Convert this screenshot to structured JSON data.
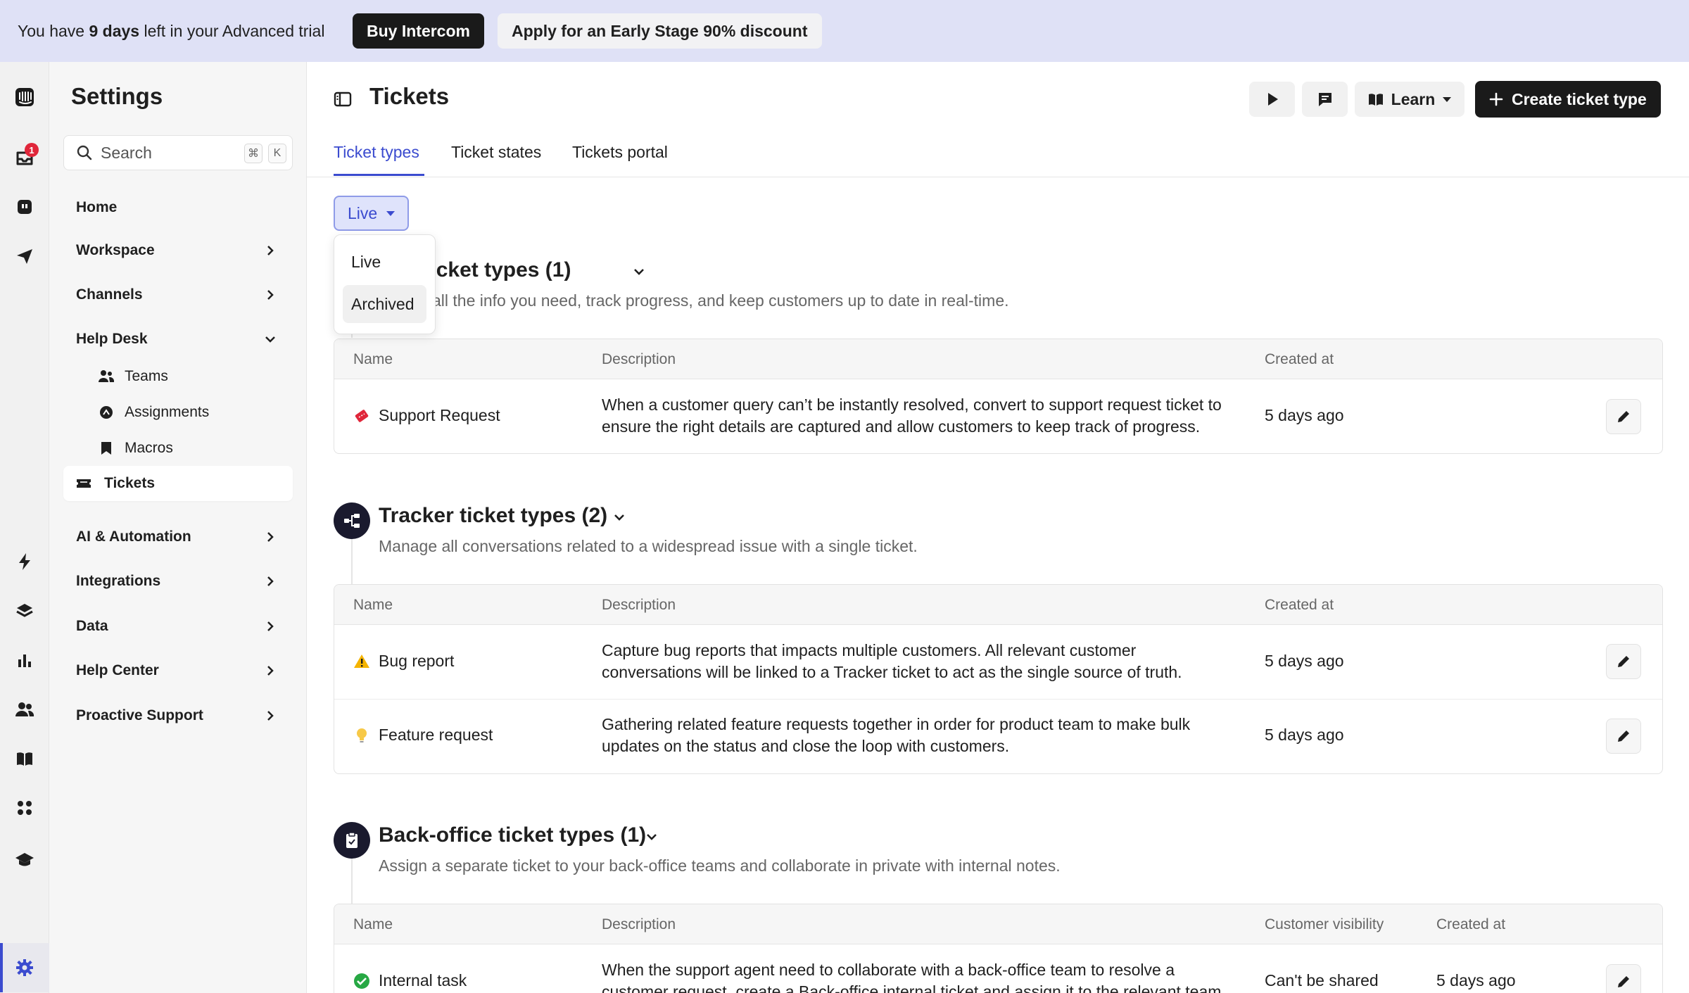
{
  "banner": {
    "prefix": "You have ",
    "days": "9 days",
    "suffix": " left in your Advanced trial",
    "buy_label": "Buy Intercom",
    "discount_label": "Apply for an Early Stage 90% discount"
  },
  "rail": {
    "inbox_badge": "1",
    "icons": [
      "intercom-logo-icon",
      "inbox-icon",
      "fin-icon",
      "outbound-icon",
      "lightning-icon",
      "layers-icon",
      "reports-icon",
      "contacts-icon",
      "knowledge-icon",
      "apps-icon",
      "academy-icon",
      "settings-icon",
      "avatar-icon"
    ]
  },
  "sidebar": {
    "title": "Settings",
    "search": {
      "placeholder": "Search",
      "shortcut_1": "⌘",
      "shortcut_2": "K"
    },
    "items": [
      {
        "label": "Home"
      },
      {
        "label": "Workspace"
      },
      {
        "label": "Channels"
      },
      {
        "label": "Help Desk"
      },
      {
        "label": "AI & Automation"
      },
      {
        "label": "Integrations"
      },
      {
        "label": "Data"
      },
      {
        "label": "Help Center"
      },
      {
        "label": "Proactive Support"
      }
    ],
    "helpdesk_sub": [
      {
        "label": "Teams"
      },
      {
        "label": "Assignments"
      },
      {
        "label": "Macros"
      },
      {
        "label": "Tickets"
      }
    ]
  },
  "header": {
    "title": "Tickets",
    "learn_label": "Learn",
    "create_label": "Create ticket type",
    "tabs": [
      {
        "label": "Ticket types"
      },
      {
        "label": "Ticket states"
      },
      {
        "label": "Tickets portal"
      }
    ]
  },
  "filter": {
    "selected": "Live",
    "options": [
      {
        "label": "Live"
      },
      {
        "label": "Archived"
      }
    ]
  },
  "sections": {
    "customer": {
      "title": "mer ticket types (1)",
      "desc": "all the info you need, track progress, and keep customers up to date in real-time.",
      "columns": {
        "name": "Name",
        "description": "Description",
        "created": "Created at"
      },
      "rows": [
        {
          "name": "Support Request",
          "description": "When a customer query can’t be instantly resolved, convert to support request ticket to ensure the right details are captured and allow customers to keep track of progress.",
          "created": "5 days ago"
        }
      ]
    },
    "tracker": {
      "title": "Tracker ticket types (2)",
      "desc": "Manage all conversations related to a widespread issue with a single ticket.",
      "columns": {
        "name": "Name",
        "description": "Description",
        "created": "Created at"
      },
      "rows": [
        {
          "name": "Bug report",
          "description": "Capture bug reports that impacts multiple customers. All relevant customer conversations will be linked to a Tracker ticket to act as the single source of truth.",
          "created": "5 days ago"
        },
        {
          "name": "Feature request",
          "description": "Gathering related feature requests together in order for product team to make bulk updates on the status and close the loop with customers.",
          "created": "5 days ago"
        }
      ]
    },
    "backoffice": {
      "title": "Back-office ticket types (1)",
      "desc": "Assign a separate ticket to your back-office teams and collaborate in private with internal notes.",
      "columns": {
        "name": "Name",
        "description": "Description",
        "visibility": "Customer visibility",
        "created": "Created at"
      },
      "rows": [
        {
          "name": "Internal task",
          "description": "When the support agent need to collaborate with a back-office team to resolve a customer request, create a Back-office internal ticket and assign it to the relevant team.",
          "visibility": "Can't be shared",
          "created": "5 days ago"
        }
      ]
    }
  },
  "colors": {
    "accent": "#3b4bcf",
    "banner_bg": "#dfe1f6",
    "dark": "#1a1a1a"
  }
}
